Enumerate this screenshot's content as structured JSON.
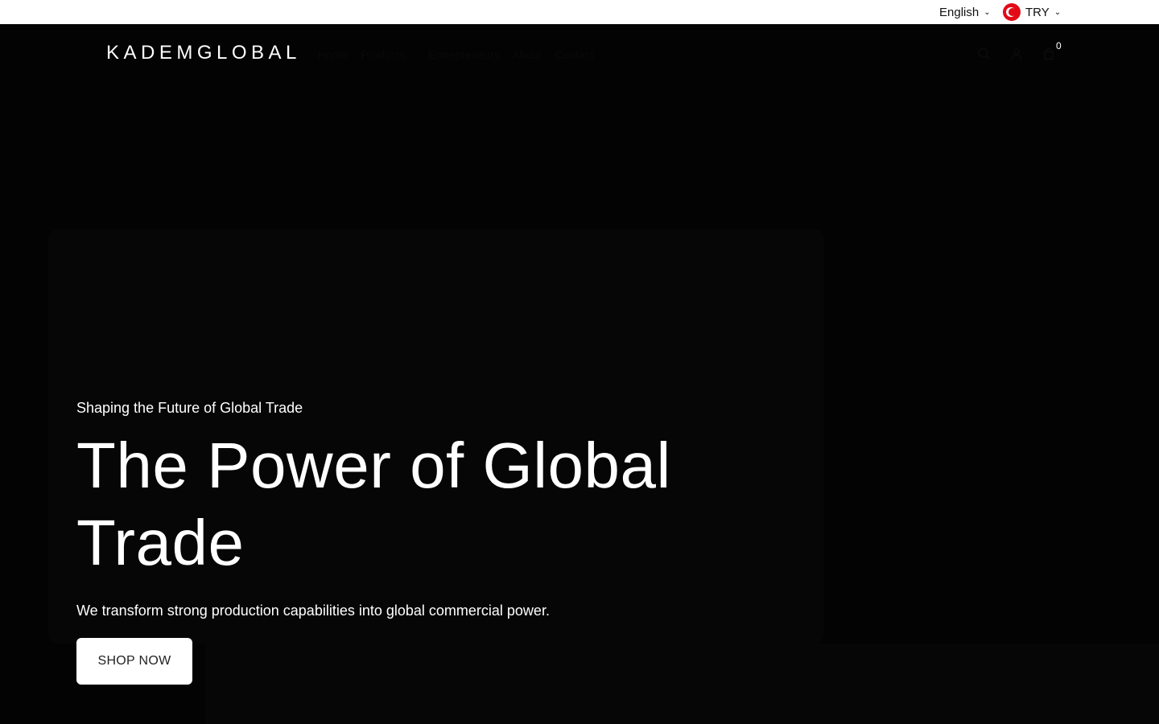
{
  "topbar": {
    "language": "English",
    "currency": "TRY"
  },
  "header": {
    "logo": "KADEMGLOBAL",
    "nav": [
      {
        "label": "Home"
      },
      {
        "label": "Products"
      },
      {
        "label": "Entrepreneurs"
      },
      {
        "label": "About"
      },
      {
        "label": "Contact"
      }
    ],
    "cart_count": "0"
  },
  "hero": {
    "kicker": "Shaping the Future of Global Trade",
    "title": "The Power of Global Trade",
    "description": "We transform strong production capabilities into global commercial power.",
    "cta_label": "SHOP NOW"
  },
  "colors": {
    "background": "#030303",
    "topbar_bg": "#ffffff",
    "accent_flag": "#e30a17"
  }
}
